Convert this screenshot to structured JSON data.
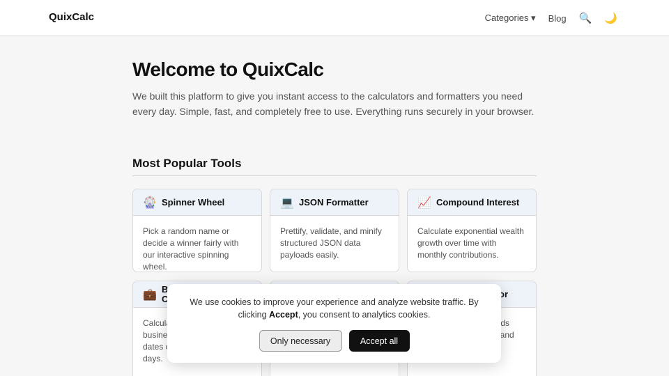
{
  "header": {
    "brand": "QuixCalc",
    "nav": {
      "categories": "Categories ▾",
      "blog": "Blog",
      "search_icon": "🔍",
      "theme_icon": "🌙"
    }
  },
  "hero": {
    "title": "Welcome to QuixCalc",
    "text": "We built this platform to give you instant access to the calculators and formatters you need every day. Simple, fast, and completely free to use. Everything runs securely in your browser."
  },
  "popular": {
    "title": "Most Popular Tools",
    "cards": [
      {
        "icon": "🎡",
        "icon_name": "ferris-wheel-icon",
        "name": "Spinner Wheel",
        "desc": "Pick a random name or decide a winner fairly with our interactive spinning wheel."
      },
      {
        "icon": "💻",
        "icon_name": "laptop-icon",
        "name": "JSON Formatter",
        "desc": "Prettify, validate, and minify structured JSON data payloads easily."
      },
      {
        "icon": "📈",
        "icon_name": "chart-increasing-icon",
        "name": "Compound Interest",
        "desc": "Calculate exponential wealth growth over time with monthly contributions."
      },
      {
        "icon": "💼",
        "icon_name": "briefcase-icon",
        "name": "B\nC",
        "desc": "Calcula\nbusines\ndates o\ndays."
      },
      {
        "icon": "",
        "icon_name": "",
        "name": "",
        "desc": ""
      },
      {
        "icon": "",
        "icon_name": "",
        "name": "or",
        "desc": "eeds\ns, and"
      }
    ]
  },
  "cookie": {
    "text_before": "We use cookies to improve your experience and analyze website traffic. By clicking ",
    "text_bold": "Accept",
    "text_after": ", you consent to analytics cookies.",
    "only_necessary": "Only necessary",
    "accept_all": "Accept all"
  }
}
